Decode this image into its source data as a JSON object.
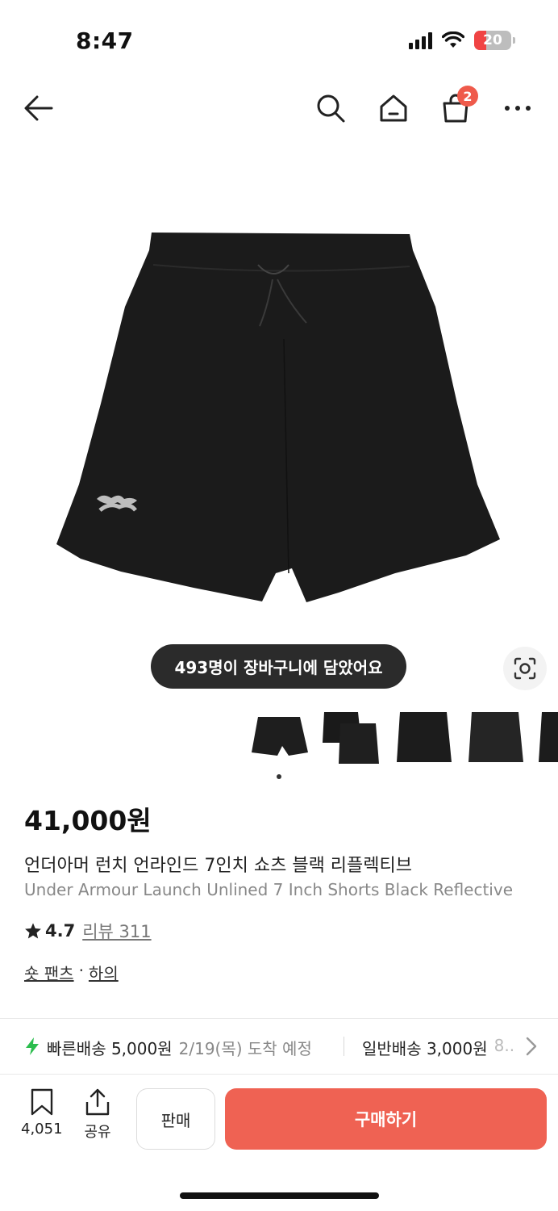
{
  "status_bar": {
    "time": "8:47",
    "battery": "20"
  },
  "header": {
    "cart_badge": "2"
  },
  "product": {
    "cart_count_message": "493명이 장바구니에 담았어요",
    "price": "41,000원",
    "name_ko": "언더아머 런치 언라인드 7인치 쇼츠 블랙 리플렉티브",
    "name_en": "Under Armour Launch Unlined 7 Inch Shorts Black Reflective",
    "rating": "4.7",
    "review_label": "리뷰 311",
    "category": "숏 팬츠",
    "category_separator": "·",
    "subcategory": "하의"
  },
  "shipping": {
    "fast_label": "빠른배송 5,000원",
    "fast_date": "2/19(목) 도착 예정",
    "normal_label": "일반배송 3,000원",
    "normal_date": "8..."
  },
  "bottom_bar": {
    "save_count": "4,051",
    "share_label": "공유",
    "sell_label": "판매",
    "buy_label": "구매하기"
  },
  "colors": {
    "accent": "#ef6253",
    "badge": "#ef5a4b",
    "fast_bolt": "#2bbd4e"
  },
  "icons": [
    "back-arrow-icon",
    "search-icon",
    "home-icon",
    "shopping-bag-icon",
    "more-icon",
    "lens-icon",
    "bookmark-icon",
    "share-icon",
    "lightning-icon",
    "chevron-right-icon",
    "star-icon"
  ]
}
